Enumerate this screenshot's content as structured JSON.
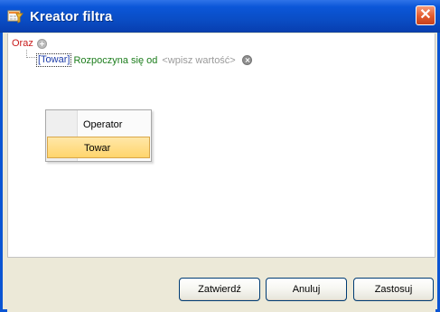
{
  "window": {
    "title": "Kreator filtra",
    "close_symbol": "✕",
    "icon_name": "filter-icon"
  },
  "tree": {
    "root_label": "Oraz",
    "condition": {
      "field": "[Towar]",
      "operator": "Rozpoczyna się od",
      "value": "<wpisz wartość>"
    }
  },
  "context_menu": {
    "items": [
      {
        "label": "Operator"
      },
      {
        "label": "Towar"
      }
    ]
  },
  "buttons": {
    "ok": "Zatwierdź",
    "cancel": "Anuluj",
    "apply": "Zastosuj"
  },
  "colors": {
    "titlebar": "#0b56d8",
    "root_text": "#c81b1b",
    "field_text": "#1d3ca8",
    "operator_text": "#1c7d1c",
    "value_text": "#9a9a9a",
    "menu_highlight": "#ffd56c"
  }
}
